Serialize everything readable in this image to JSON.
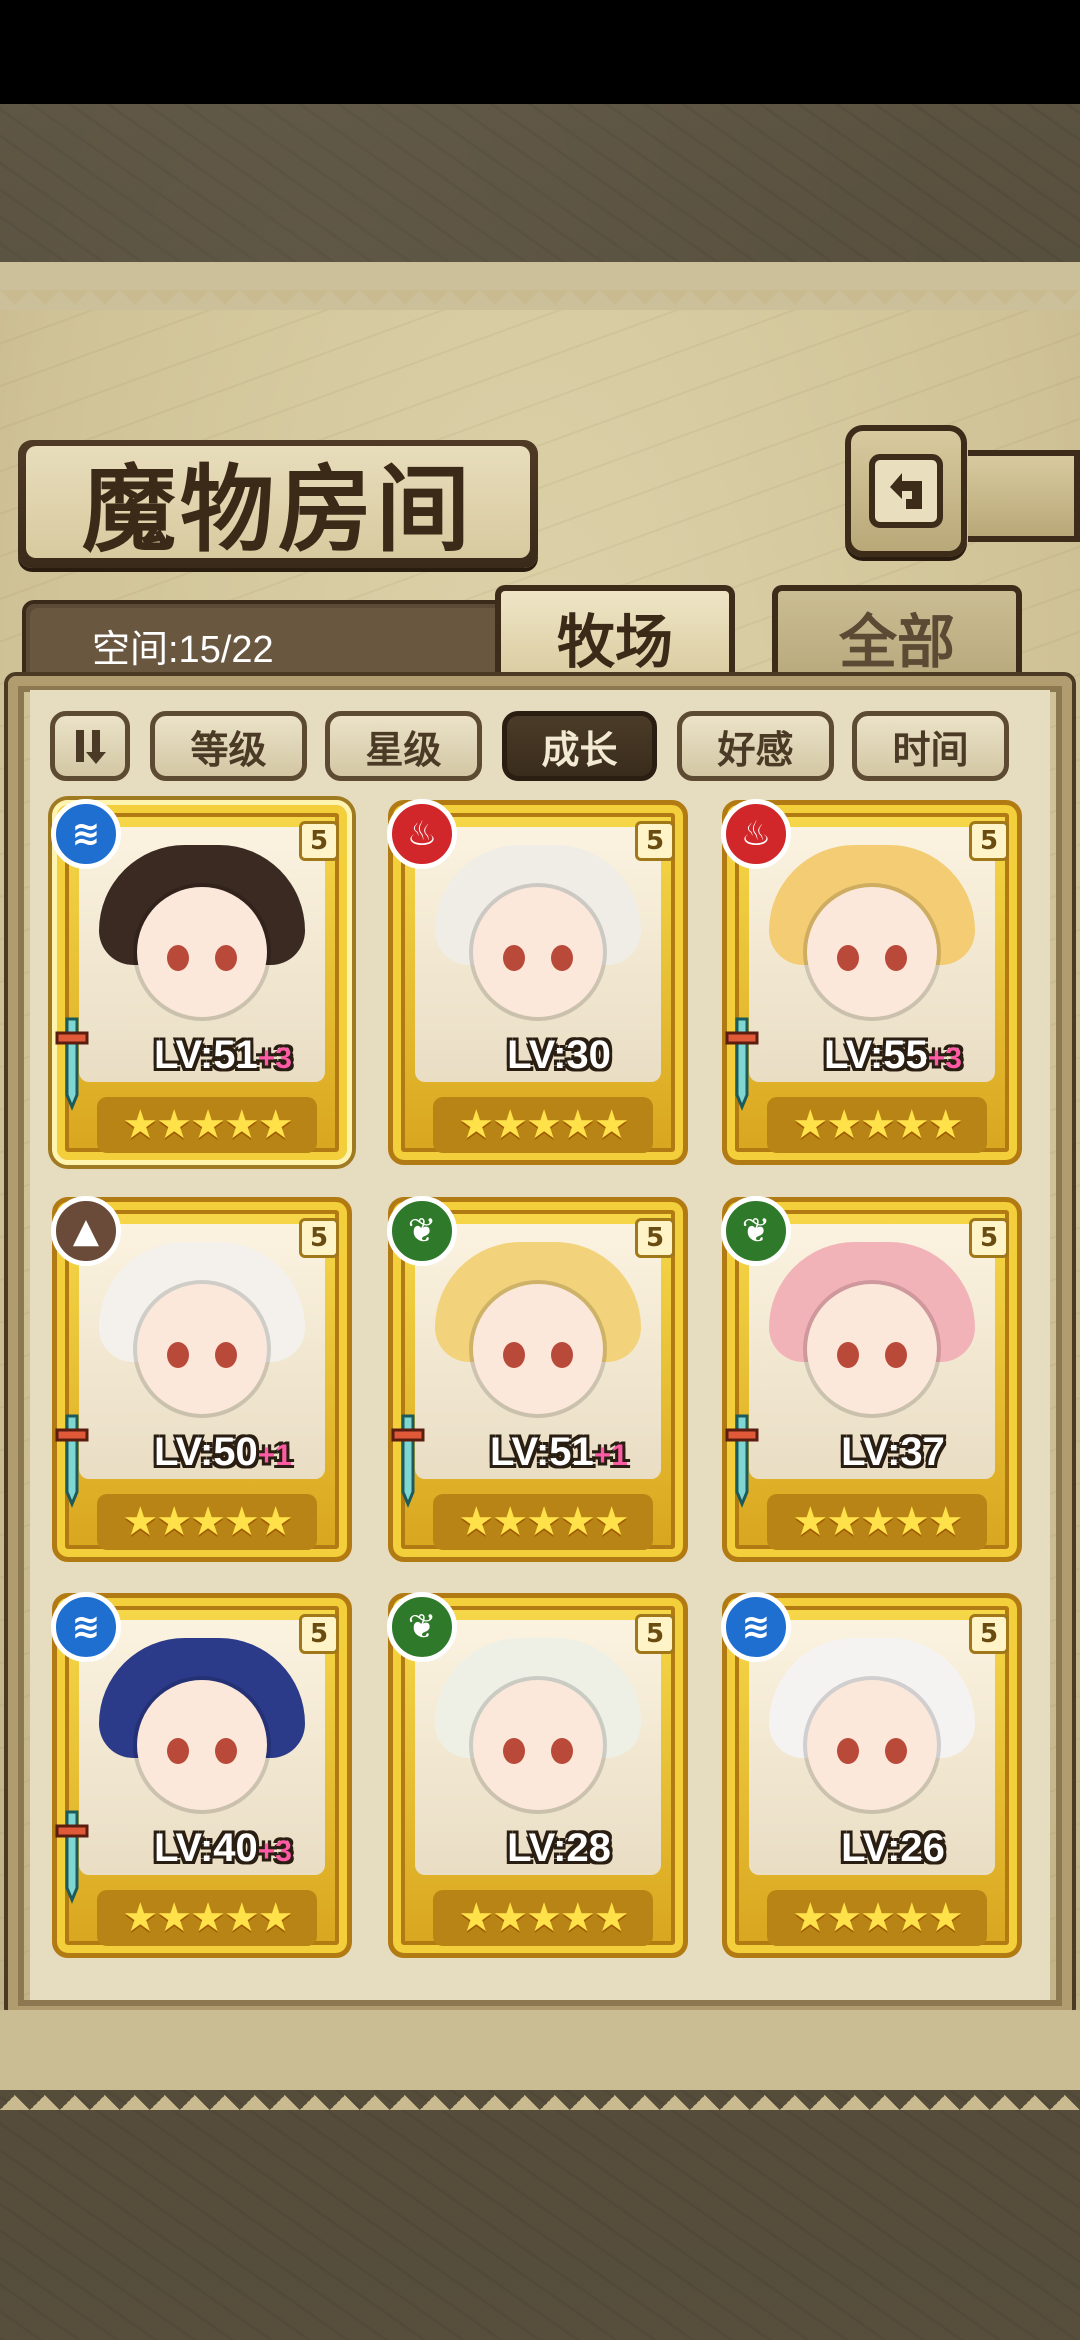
{
  "header": {
    "title": "魔物房间",
    "back_button_icon": "back-arrow-icon"
  },
  "info": {
    "space_label": "空间:15/22"
  },
  "tabs": [
    {
      "label": "牧场",
      "active": true
    },
    {
      "label": "全部",
      "active": false
    }
  ],
  "sort": {
    "order_icon": "sort-order-icon",
    "options": [
      {
        "label": "等级",
        "active": false
      },
      {
        "label": "星级",
        "active": false
      },
      {
        "label": "成长",
        "active": true
      },
      {
        "label": "好感",
        "active": false
      },
      {
        "label": "时间",
        "active": false
      }
    ]
  },
  "monsters": [
    {
      "element": "water",
      "level": "LV:51",
      "bonus": "+3",
      "stars": 5,
      "rank": "5",
      "weapon": true,
      "selected": true
    },
    {
      "element": "fire",
      "level": "LV:30",
      "bonus": "",
      "stars": 5,
      "rank": "5",
      "weapon": false,
      "selected": false
    },
    {
      "element": "fire",
      "level": "LV:55",
      "bonus": "+3",
      "stars": 5,
      "rank": "5",
      "weapon": true,
      "selected": false
    },
    {
      "element": "earth",
      "level": "LV:50",
      "bonus": "+1",
      "stars": 5,
      "rank": "5",
      "weapon": true,
      "selected": false
    },
    {
      "element": "wood",
      "level": "LV:51",
      "bonus": "+1",
      "stars": 5,
      "rank": "5",
      "weapon": true,
      "selected": false
    },
    {
      "element": "wood",
      "level": "LV:37",
      "bonus": "",
      "stars": 5,
      "rank": "5",
      "weapon": true,
      "selected": false
    },
    {
      "element": "water",
      "level": "LV:40",
      "bonus": "+3",
      "stars": 5,
      "rank": "5",
      "weapon": true,
      "selected": false
    },
    {
      "element": "wood",
      "level": "LV:28",
      "bonus": "",
      "stars": 5,
      "rank": "5",
      "weapon": false,
      "selected": false
    },
    {
      "element": "water",
      "level": "LV:26",
      "bonus": "",
      "stars": 5,
      "rank": "5",
      "weapon": false,
      "selected": false
    }
  ],
  "colors": {
    "water": "#1f6fd0",
    "fire": "#d1262a",
    "earth": "#6a4a38",
    "wood": "#2f7a2a"
  }
}
